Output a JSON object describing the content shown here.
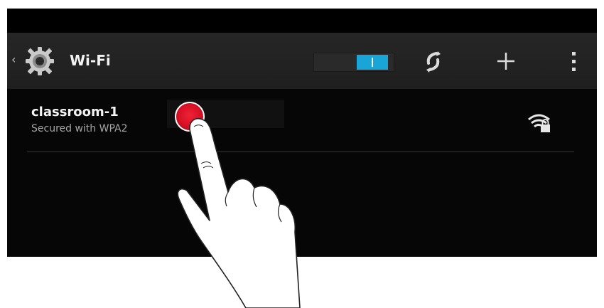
{
  "header": {
    "title": "Wi-Fi",
    "toggle_state": "on",
    "icons": [
      "settings-icon",
      "scan-icon",
      "add-icon",
      "overflow-menu-icon"
    ]
  },
  "networks": [
    {
      "name": "classroom-1",
      "status": "Secured with WPA2",
      "icon": "wifi-lock-icon"
    }
  ],
  "colors": {
    "toggle_on": "#19a5d8",
    "touch_indicator": "#d50f24",
    "background": "#000000"
  }
}
